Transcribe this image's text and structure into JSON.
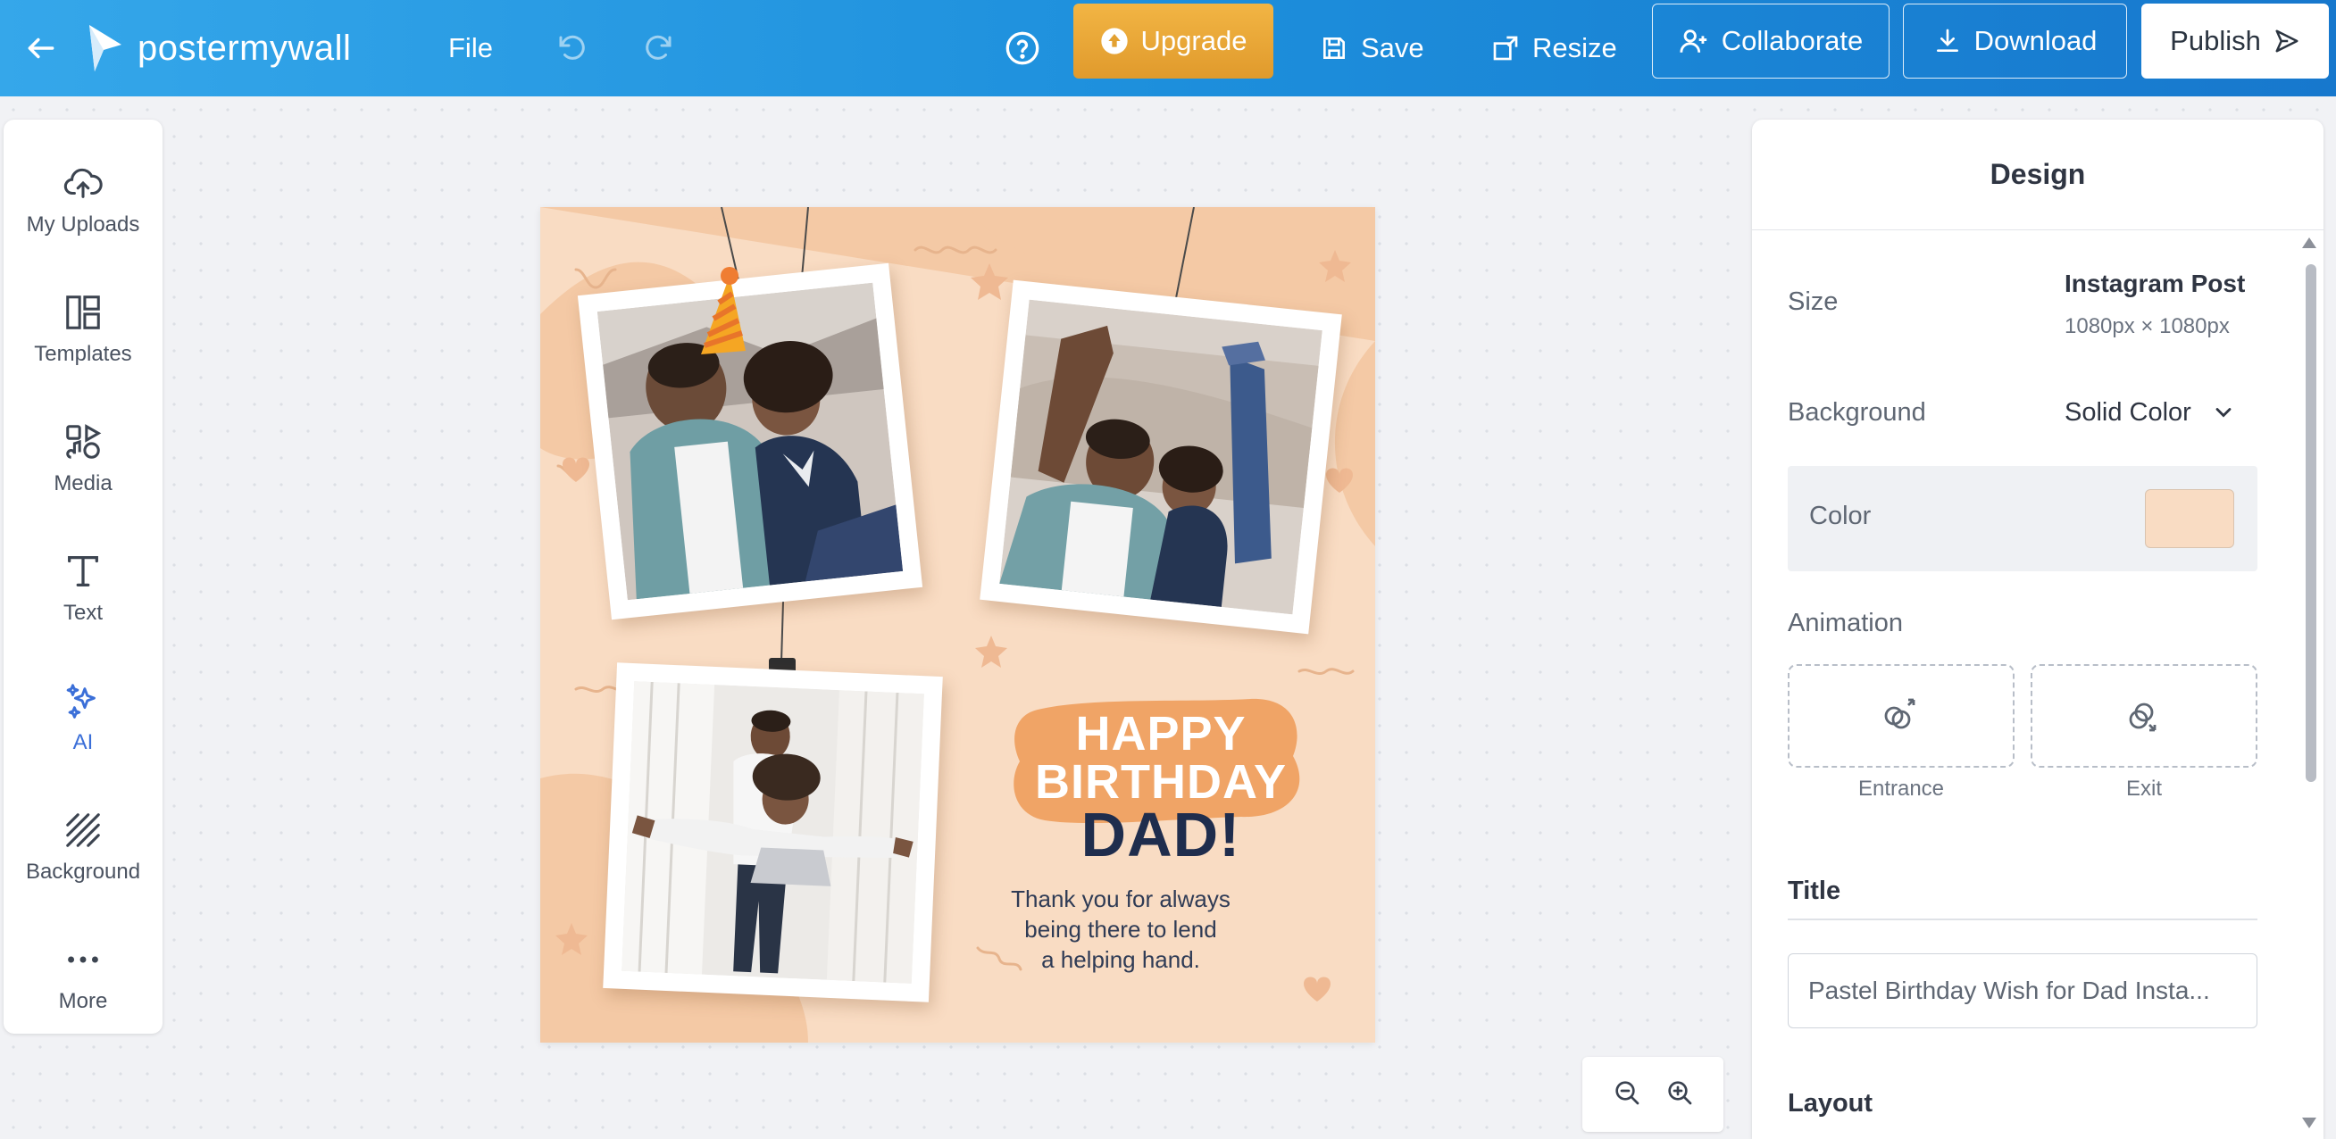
{
  "topbar": {
    "brand": "postermywall",
    "file_label": "File",
    "upgrade_label": "Upgrade",
    "save_label": "Save",
    "resize_label": "Resize",
    "collaborate_label": "Collaborate",
    "download_label": "Download",
    "publish_label": "Publish"
  },
  "sidebar": {
    "items": [
      {
        "label": "My Uploads",
        "icon": "upload-cloud-icon"
      },
      {
        "label": "Templates",
        "icon": "templates-icon"
      },
      {
        "label": "Media",
        "icon": "media-icon"
      },
      {
        "label": "Text",
        "icon": "text-icon"
      },
      {
        "label": "AI",
        "icon": "ai-sparkle-icon"
      },
      {
        "label": "Background",
        "icon": "background-icon"
      },
      {
        "label": "More",
        "icon": "more-dots-icon"
      }
    ]
  },
  "poster": {
    "line1": "HAPPY",
    "line2": "BIRTHDAY",
    "line3": "DAD!",
    "message_line1": "Thank you for always",
    "message_line2": "being there to lend",
    "message_line3": "a helping hand.",
    "background_color": "#f9dcc3",
    "accent_color": "#f0a466"
  },
  "panel": {
    "heading": "Design",
    "size_label": "Size",
    "size_value": "Instagram Post",
    "size_dims": "1080px × 1080px",
    "background_label": "Background",
    "background_value": "Solid Color",
    "color_label": "Color",
    "animation_label": "Animation",
    "entrance_label": "Entrance",
    "exit_label": "Exit",
    "title_label": "Title",
    "title_value": "Pastel Birthday Wish for Dad Insta...",
    "layout_label": "Layout"
  },
  "colors": {
    "topbar_start": "#35a7ea",
    "topbar_end": "#1778cd",
    "upgrade": "#e8a735",
    "ai_accent": "#3b6fd8"
  }
}
